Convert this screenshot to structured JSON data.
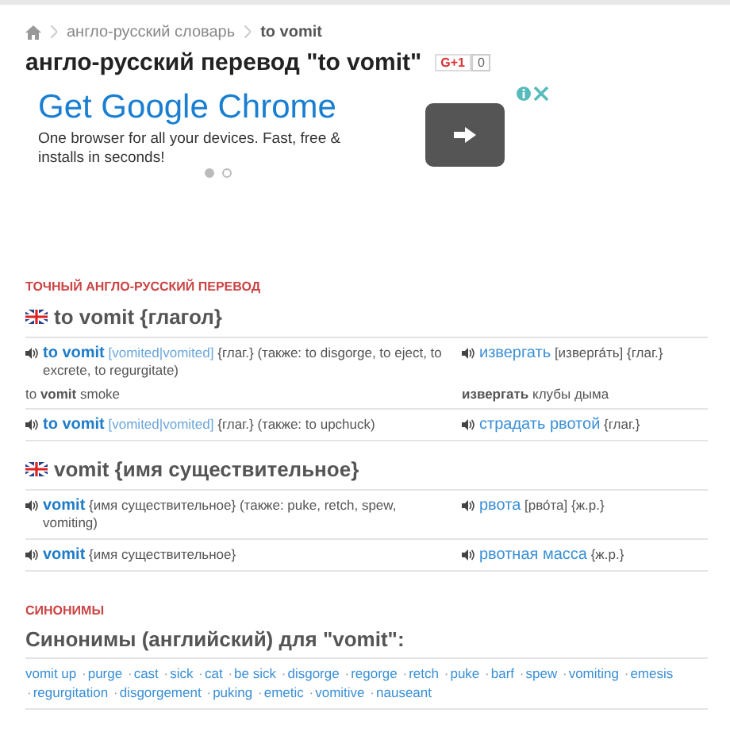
{
  "breadcrumb": [
    {
      "label": "англо-русский словарь"
    },
    {
      "label": "to vomit"
    }
  ],
  "title": "англо-русский перевод \"to vomit\"",
  "plus_one": {
    "label": "G+1",
    "count": "0"
  },
  "ad": {
    "headline": "Get Google Chrome",
    "body": "One browser for all your devices. Fast, free & installs in seconds!",
    "dots": [
      {
        "selected": true
      },
      {
        "selected": false
      }
    ]
  },
  "translation": {
    "label": "ТОЧНЫЙ АНГЛО-РУССКИЙ ПЕРЕВОД",
    "groups": [
      {
        "heading": "to vomit {глагол}",
        "entries": [
          {
            "term": "to vomit",
            "forms": "[vomited|vomited]",
            "pos": "{глаг.}",
            "extra": "(также: to disgorge, to eject, to excrete, to regurgitate)",
            "translation": "извергать",
            "translation_forms": "[изверга́ть]",
            "translation_pos": "{глаг.}",
            "example_en": "to **vomit** smoke",
            "example_ru": "**извергать** клубы дыма"
          },
          {
            "term": "to vomit",
            "forms": "[vomited|vomited]",
            "pos": "{глаг.}",
            "extra": "(также: to upchuck)",
            "translation": "страдать рвотой",
            "translation_pos": "{глаг.}"
          }
        ]
      },
      {
        "heading": "vomit {имя существительное}",
        "entries": [
          {
            "term": "vomit",
            "pos": "{имя существительное}",
            "extra": "(также: puke, retch, spew, vomiting)",
            "translation": "рвота",
            "translation_forms": "[рво́та]",
            "translation_pos": "{ж.р.}"
          },
          {
            "term": "vomit",
            "pos": "{имя существительное}",
            "translation": "рвотная масса",
            "translation_pos": "{ж.р.}"
          }
        ]
      }
    ]
  },
  "synonyms": {
    "label": "СИНОНИМЫ",
    "heading": "Синонимы (английский) для \"vomit\":",
    "separator": "·",
    "words": [
      "vomit up",
      "purge",
      "cast",
      "sick",
      "cat",
      "be sick",
      "disgorge",
      "regorge",
      "retch",
      "puke",
      "barf",
      "spew",
      "vomiting",
      "emesis",
      "regurgitation",
      "disgorgement",
      "puking",
      "emetic",
      "vomitive",
      "nauseant"
    ]
  }
}
